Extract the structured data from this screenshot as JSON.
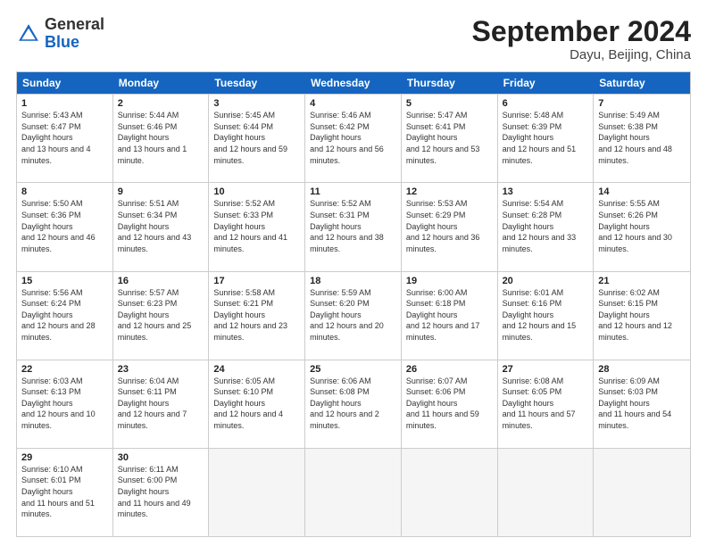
{
  "header": {
    "logo_general": "General",
    "logo_blue": "Blue",
    "month_title": "September 2024",
    "location": "Dayu, Beijing, China"
  },
  "days_of_week": [
    "Sunday",
    "Monday",
    "Tuesday",
    "Wednesday",
    "Thursday",
    "Friday",
    "Saturday"
  ],
  "weeks": [
    [
      {
        "num": "1",
        "sunrise": "5:43 AM",
        "sunset": "6:47 PM",
        "daylight": "13 hours and 4 minutes."
      },
      {
        "num": "2",
        "sunrise": "5:44 AM",
        "sunset": "6:46 PM",
        "daylight": "13 hours and 1 minute."
      },
      {
        "num": "3",
        "sunrise": "5:45 AM",
        "sunset": "6:44 PM",
        "daylight": "12 hours and 59 minutes."
      },
      {
        "num": "4",
        "sunrise": "5:46 AM",
        "sunset": "6:42 PM",
        "daylight": "12 hours and 56 minutes."
      },
      {
        "num": "5",
        "sunrise": "5:47 AM",
        "sunset": "6:41 PM",
        "daylight": "12 hours and 53 minutes."
      },
      {
        "num": "6",
        "sunrise": "5:48 AM",
        "sunset": "6:39 PM",
        "daylight": "12 hours and 51 minutes."
      },
      {
        "num": "7",
        "sunrise": "5:49 AM",
        "sunset": "6:38 PM",
        "daylight": "12 hours and 48 minutes."
      }
    ],
    [
      {
        "num": "8",
        "sunrise": "5:50 AM",
        "sunset": "6:36 PM",
        "daylight": "12 hours and 46 minutes."
      },
      {
        "num": "9",
        "sunrise": "5:51 AM",
        "sunset": "6:34 PM",
        "daylight": "12 hours and 43 minutes."
      },
      {
        "num": "10",
        "sunrise": "5:52 AM",
        "sunset": "6:33 PM",
        "daylight": "12 hours and 41 minutes."
      },
      {
        "num": "11",
        "sunrise": "5:52 AM",
        "sunset": "6:31 PM",
        "daylight": "12 hours and 38 minutes."
      },
      {
        "num": "12",
        "sunrise": "5:53 AM",
        "sunset": "6:29 PM",
        "daylight": "12 hours and 36 minutes."
      },
      {
        "num": "13",
        "sunrise": "5:54 AM",
        "sunset": "6:28 PM",
        "daylight": "12 hours and 33 minutes."
      },
      {
        "num": "14",
        "sunrise": "5:55 AM",
        "sunset": "6:26 PM",
        "daylight": "12 hours and 30 minutes."
      }
    ],
    [
      {
        "num": "15",
        "sunrise": "5:56 AM",
        "sunset": "6:24 PM",
        "daylight": "12 hours and 28 minutes."
      },
      {
        "num": "16",
        "sunrise": "5:57 AM",
        "sunset": "6:23 PM",
        "daylight": "12 hours and 25 minutes."
      },
      {
        "num": "17",
        "sunrise": "5:58 AM",
        "sunset": "6:21 PM",
        "daylight": "12 hours and 23 minutes."
      },
      {
        "num": "18",
        "sunrise": "5:59 AM",
        "sunset": "6:20 PM",
        "daylight": "12 hours and 20 minutes."
      },
      {
        "num": "19",
        "sunrise": "6:00 AM",
        "sunset": "6:18 PM",
        "daylight": "12 hours and 17 minutes."
      },
      {
        "num": "20",
        "sunrise": "6:01 AM",
        "sunset": "6:16 PM",
        "daylight": "12 hours and 15 minutes."
      },
      {
        "num": "21",
        "sunrise": "6:02 AM",
        "sunset": "6:15 PM",
        "daylight": "12 hours and 12 minutes."
      }
    ],
    [
      {
        "num": "22",
        "sunrise": "6:03 AM",
        "sunset": "6:13 PM",
        "daylight": "12 hours and 10 minutes."
      },
      {
        "num": "23",
        "sunrise": "6:04 AM",
        "sunset": "6:11 PM",
        "daylight": "12 hours and 7 minutes."
      },
      {
        "num": "24",
        "sunrise": "6:05 AM",
        "sunset": "6:10 PM",
        "daylight": "12 hours and 4 minutes."
      },
      {
        "num": "25",
        "sunrise": "6:06 AM",
        "sunset": "6:08 PM",
        "daylight": "12 hours and 2 minutes."
      },
      {
        "num": "26",
        "sunrise": "6:07 AM",
        "sunset": "6:06 PM",
        "daylight": "11 hours and 59 minutes."
      },
      {
        "num": "27",
        "sunrise": "6:08 AM",
        "sunset": "6:05 PM",
        "daylight": "11 hours and 57 minutes."
      },
      {
        "num": "28",
        "sunrise": "6:09 AM",
        "sunset": "6:03 PM",
        "daylight": "11 hours and 54 minutes."
      }
    ],
    [
      {
        "num": "29",
        "sunrise": "6:10 AM",
        "sunset": "6:01 PM",
        "daylight": "11 hours and 51 minutes."
      },
      {
        "num": "30",
        "sunrise": "6:11 AM",
        "sunset": "6:00 PM",
        "daylight": "11 hours and 49 minutes."
      },
      null,
      null,
      null,
      null,
      null
    ]
  ]
}
